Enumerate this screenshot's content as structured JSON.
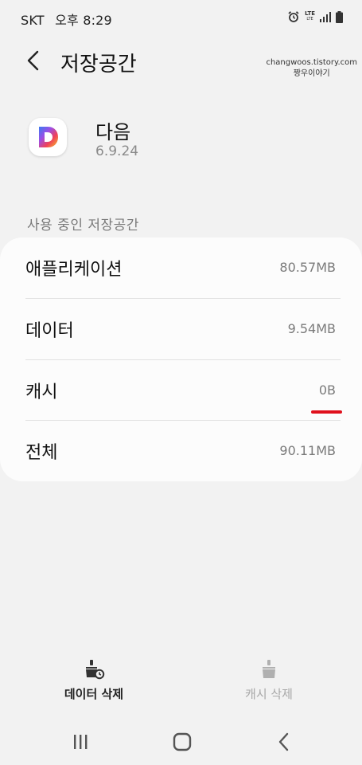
{
  "status_bar": {
    "carrier": "SKT",
    "time": "오후 8:29",
    "network": "LTE",
    "network_sub": "LTE"
  },
  "header": {
    "title": "저장공간",
    "watermark_line1": "changwoos.tistory.com",
    "watermark_line2": "짱우이야기"
  },
  "app": {
    "name": "다음",
    "version": "6.9.24",
    "icon_letter": "D"
  },
  "storage": {
    "section_label": "사용 중인 저장공간",
    "rows": [
      {
        "label": "애플리케이션",
        "value": "80.57MB"
      },
      {
        "label": "데이터",
        "value": "9.54MB"
      },
      {
        "label": "캐시",
        "value": "0B"
      },
      {
        "label": "전체",
        "value": "90.11MB"
      }
    ]
  },
  "actions": {
    "clear_data": "데이터 삭제",
    "clear_cache": "캐시 삭제"
  },
  "colors": {
    "background": "#f2f2f2",
    "card": "#fcfcfc",
    "highlight": "#e0101c"
  }
}
